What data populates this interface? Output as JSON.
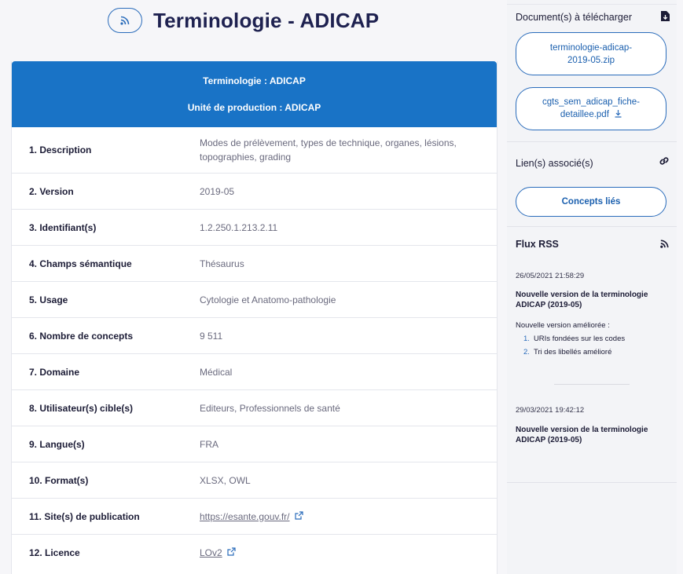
{
  "page": {
    "title": "Terminologie - ADICAP",
    "title_icon": "rss-icon"
  },
  "table": {
    "header_line1": "Terminologie : ADICAP",
    "header_line2": "Unité de production : ADICAP",
    "rows": [
      {
        "label": "1. Description",
        "value": "Modes de prélèvement, types de technique, organes, lésions, topographies, grading"
      },
      {
        "label": "2. Version",
        "value": "2019-05"
      },
      {
        "label": "3. Identifiant(s)",
        "value": "1.2.250.1.213.2.11"
      },
      {
        "label": "4. Champs sémantique",
        "value": "Thésaurus"
      },
      {
        "label": "5. Usage",
        "value": "Cytologie et Anatomo-pathologie"
      },
      {
        "label": "6. Nombre de concepts",
        "value": "9 511"
      },
      {
        "label": "7. Domaine",
        "value": "Médical"
      },
      {
        "label": "8. Utilisateur(s) cible(s)",
        "value": "Editeurs, Professionnels de santé"
      },
      {
        "label": "9. Langue(s)",
        "value": "FRA"
      },
      {
        "label": "10. Format(s)",
        "value": "XLSX, OWL"
      },
      {
        "label": "11. Site(s) de publication",
        "value": "https://esante.gouv.fr/",
        "link": true
      },
      {
        "label": "12. Licence",
        "value": "LOv2",
        "link": true
      }
    ],
    "header_color": "#1973c6"
  },
  "sidebar": {
    "downloads_title": "Document(s) à télécharger",
    "downloads": [
      {
        "line1": "terminologie-adicap-",
        "line2": "2019-05.zip"
      },
      {
        "line1": "cgts_sem_adicap_fiche-",
        "line2": "detaillee.pdf"
      }
    ],
    "links_title": "Lien(s) associé(s)",
    "concepts_button": "Concepts liés",
    "rss_title": "Flux RSS",
    "rss_items": [
      {
        "date": "26/05/2021 21:58:29",
        "title": "Nouvelle version de la terminologie ADICAP (2019-05)",
        "desc": "Nouvelle version améliorée :",
        "list": [
          {
            "num": "1.",
            "text": "URIs fondées sur les codes"
          },
          {
            "num": "2.",
            "text": "Tri des libellés amélioré"
          }
        ]
      },
      {
        "date": "29/03/2021 19:42:12",
        "title": "Nouvelle version de la terminologie ADICAP (2019-05)"
      }
    ],
    "accent_color": "#2a6cbb"
  }
}
